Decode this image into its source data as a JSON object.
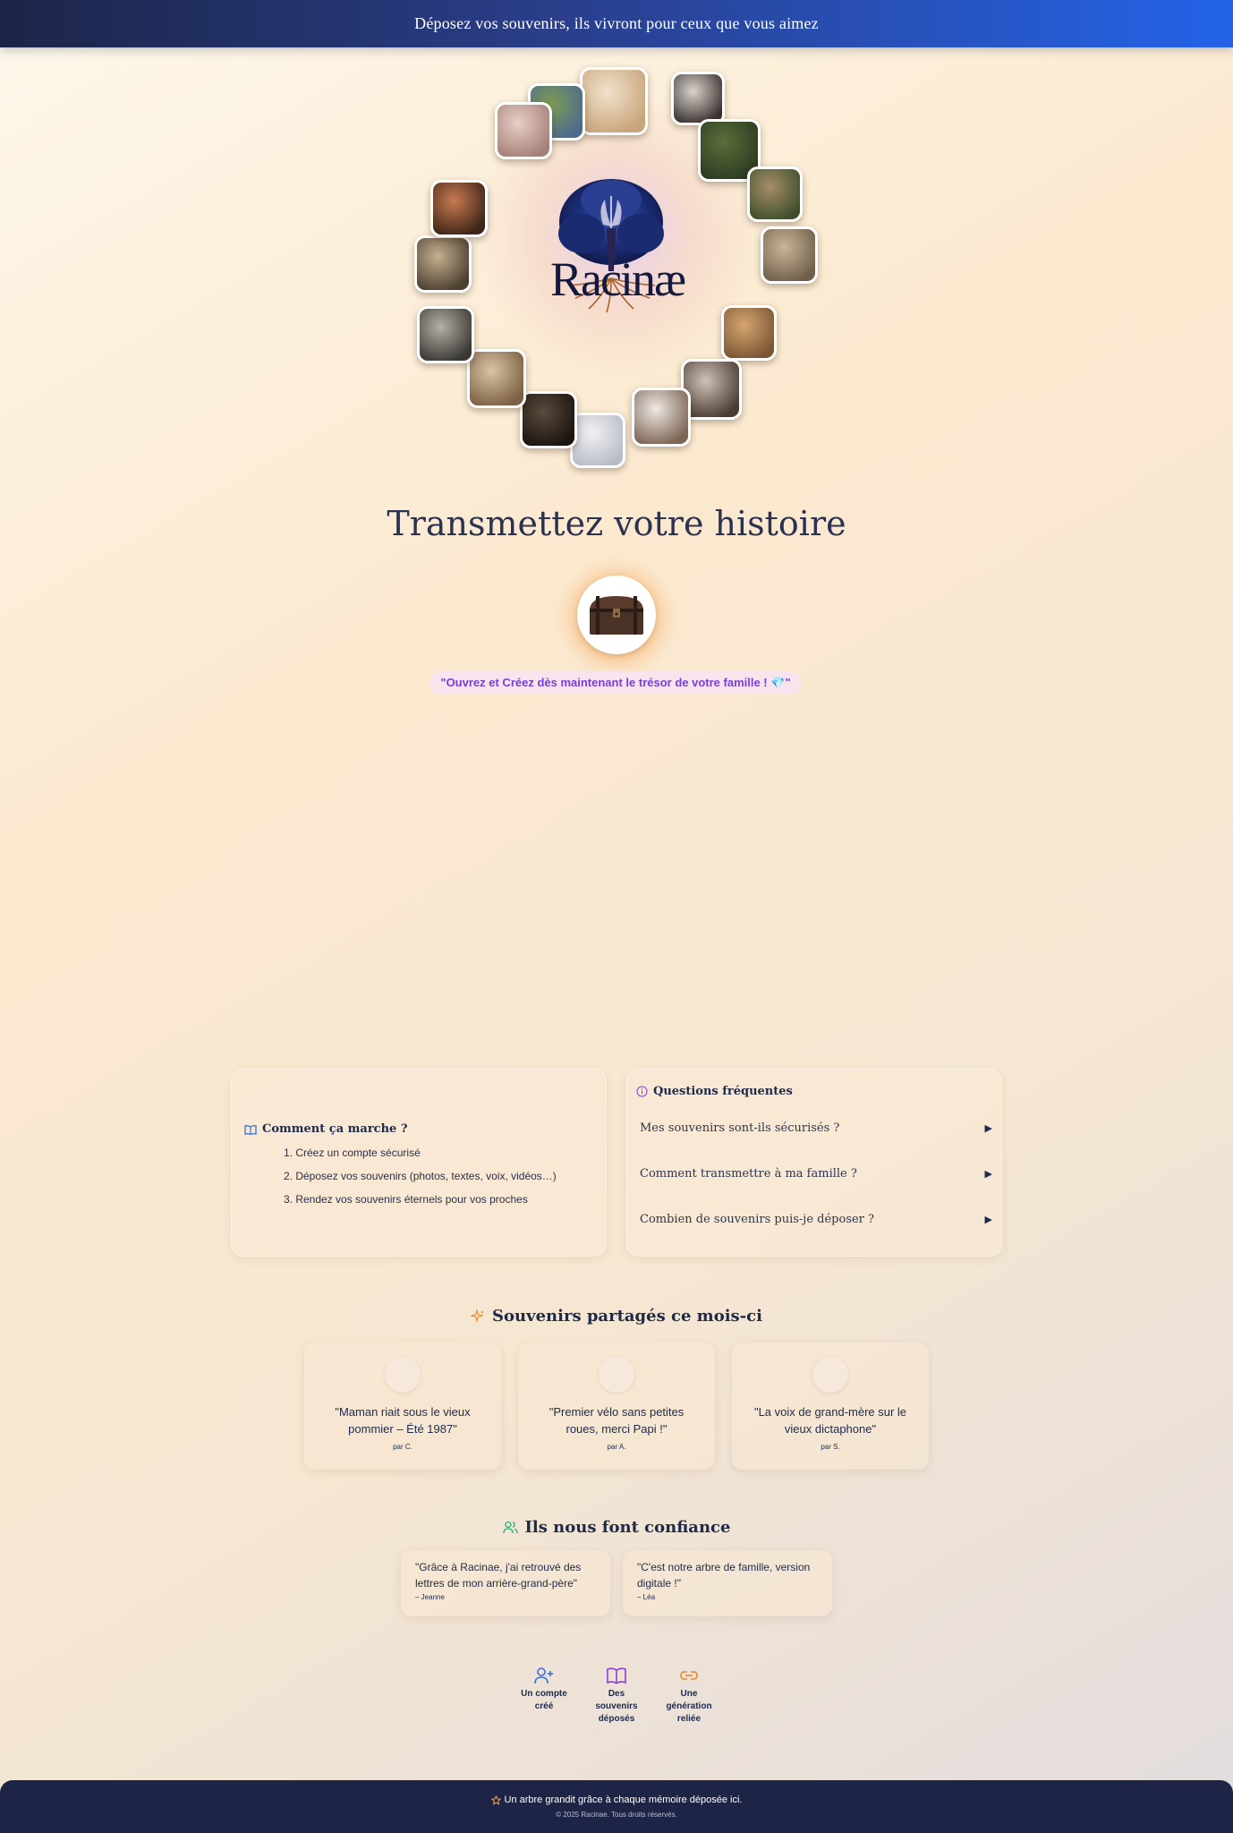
{
  "banner": {
    "text": "Déposez vos souvenirs, ils vivront pour ceux que vous aimez"
  },
  "hero": {
    "logo_text": "Racinæ",
    "photos": [
      {
        "name": "photo-scroll",
        "colors": [
          "#f0e2cc",
          "#c9a47a"
        ]
      },
      {
        "name": "photo-family-outdoor",
        "colors": [
          "#7d9c52",
          "#4d6a8e"
        ]
      },
      {
        "name": "photo-pink-family",
        "colors": [
          "#e8cfc6",
          "#a48077"
        ]
      },
      {
        "name": "photo-old-portrait",
        "colors": [
          "#d9d3cb",
          "#3a3230"
        ]
      },
      {
        "name": "photo-family-field",
        "colors": [
          "#5b6e3a",
          "#2d3a22"
        ]
      },
      {
        "name": "photo-kids-grass",
        "colors": [
          "#a58e67",
          "#3f4f2d"
        ]
      },
      {
        "name": "photo-sepia-group",
        "colors": [
          "#c9b59a",
          "#6f5f4a"
        ]
      },
      {
        "name": "photo-mother-child",
        "colors": [
          "#d6a570",
          "#7a5634"
        ]
      },
      {
        "name": "photo-family-couch",
        "colors": [
          "#cfc1b5",
          "#4a3b33"
        ]
      },
      {
        "name": "photo-family-dog",
        "colors": [
          "#efe9e4",
          "#7b6453"
        ]
      },
      {
        "name": "photo-baby",
        "colors": [
          "#f1f1f3",
          "#b9bcc7"
        ]
      },
      {
        "name": "photo-open-book",
        "colors": [
          "#5a4a3c",
          "#1c1410"
        ]
      },
      {
        "name": "photo-old-group",
        "colors": [
          "#d9c4a4",
          "#7c5f44"
        ]
      },
      {
        "name": "photo-family-bw",
        "colors": [
          "#b4b0a6",
          "#3a3834"
        ]
      },
      {
        "name": "photo-sepia-family",
        "colors": [
          "#c4b090",
          "#4c3f30"
        ]
      },
      {
        "name": "photo-kids-red",
        "colors": [
          "#c87a52",
          "#3e2416"
        ]
      }
    ]
  },
  "main": {
    "title": "Transmettez votre histoire",
    "cta": "\"Ouvrez et Créez dès maintenant le trésor de votre famille ! 💎\""
  },
  "how": {
    "title": "Comment ça marche ?",
    "steps": [
      "1. Créez un compte sécurisé",
      "2. Déposez vos souvenirs (photos, textes, voix, vidéos…)",
      "3. Rendez vos souvenirs éternels pour vos proches"
    ]
  },
  "faq": {
    "title": "Questions fréquentes",
    "items": [
      "Mes souvenirs sont-ils sécurisés ?",
      "Comment transmettre à ma famille ?",
      "Combien de souvenirs puis-je déposer ?"
    ]
  },
  "memories": {
    "title": "Souvenirs partagés ce mois-ci",
    "items": [
      {
        "quote": "\"Maman riait sous le vieux pommier – Été 1987\"",
        "author": "par C."
      },
      {
        "quote": "\"Premier vélo sans petites roues, merci Papi !\"",
        "author": "par A."
      },
      {
        "quote": "\"La voix de grand-mère sur le vieux dictaphone\"",
        "author": "par S."
      }
    ]
  },
  "trust": {
    "title": "Ils nous font confiance",
    "items": [
      {
        "quote": "\"Grâce à Racinae, j'ai retrouvé des lettres de mon arrière-grand-père\"",
        "author": "– Jeanne"
      },
      {
        "quote": "\"C'est notre arbre de famille, version digitale !\"",
        "author": "– Léa"
      }
    ]
  },
  "stats": [
    {
      "label": "Un compte créé",
      "icon": "user-plus-icon",
      "color": "#3b6fd8"
    },
    {
      "label": "Des souvenirs déposés",
      "icon": "book-open-icon",
      "color": "#8a3fd8"
    },
    {
      "label": "Une génération reliée",
      "icon": "link-icon",
      "color": "#e8923a"
    }
  ],
  "footer": {
    "tagline": "Un arbre grandit grâce à chaque mémoire déposée ici.",
    "copyright": "© 2025 Racinae. Tous droits réservés."
  },
  "colors": {
    "accent_blue": "#2463e8",
    "navy": "#1d2446",
    "purple": "#7a3fd8",
    "orange": "#e8923a",
    "green": "#2fae7a"
  }
}
